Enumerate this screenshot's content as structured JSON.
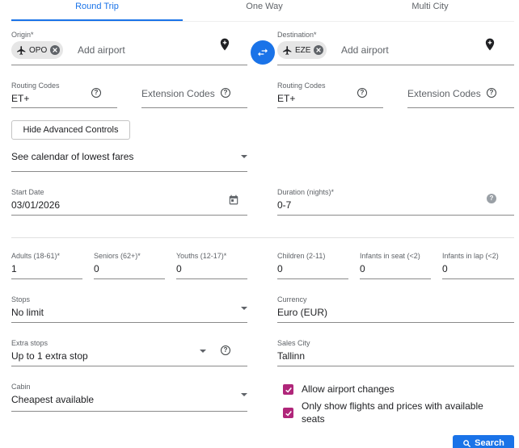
{
  "tabs": [
    {
      "label": "Round Trip",
      "active": true
    },
    {
      "label": "One Way",
      "active": false
    },
    {
      "label": "Multi City",
      "active": false
    }
  ],
  "origin": {
    "label": "Origin*",
    "chip": "OPO",
    "placeholder": "Add airport"
  },
  "destination": {
    "label": "Destination*",
    "chip": "EZE",
    "placeholder": "Add airport"
  },
  "routing_left": {
    "label": "Routing Codes",
    "value": "ET+"
  },
  "extension_left": {
    "placeholder": "Extension Codes"
  },
  "routing_right": {
    "label": "Routing Codes",
    "value": "ET+"
  },
  "extension_right": {
    "placeholder": "Extension Codes"
  },
  "advanced_button": "Hide Advanced Controls",
  "calendar_select": "See calendar of lowest fares",
  "start_date": {
    "label": "Start Date",
    "value": "03/01/2026"
  },
  "duration": {
    "label": "Duration (nights)*",
    "value": "0-7"
  },
  "passengers": [
    {
      "label": "Adults (18-61)*",
      "value": "1"
    },
    {
      "label": "Seniors (62+)*",
      "value": "0"
    },
    {
      "label": "Youths (12-17)*",
      "value": "0"
    },
    {
      "label": "Children (2-11)",
      "value": "0"
    },
    {
      "label": "Infants in seat (<2)",
      "value": "0"
    },
    {
      "label": "Infants in lap (<2)",
      "value": "0"
    }
  ],
  "stops": {
    "label": "Stops",
    "value": "No limit"
  },
  "currency": {
    "label": "Currency",
    "value": "Euro (EUR)"
  },
  "extra_stops": {
    "label": "Extra stops",
    "value": "Up to 1 extra stop"
  },
  "sales_city": {
    "label": "Sales City",
    "value": "Tallinn"
  },
  "cabin": {
    "label": "Cabin",
    "value": "Cheapest available"
  },
  "checkboxes": [
    {
      "label": "Allow airport changes",
      "checked": true
    },
    {
      "label": "Only show flights and prices with available seats",
      "checked": true
    }
  ],
  "search_button": "Search",
  "icons": [
    "airplane-icon",
    "clear-icon",
    "add-location-icon",
    "swap-icon",
    "help-icon",
    "calendar-icon",
    "search-icon"
  ],
  "colors": {
    "accent": "#1a73e8",
    "checkbox": "#b0267a"
  }
}
